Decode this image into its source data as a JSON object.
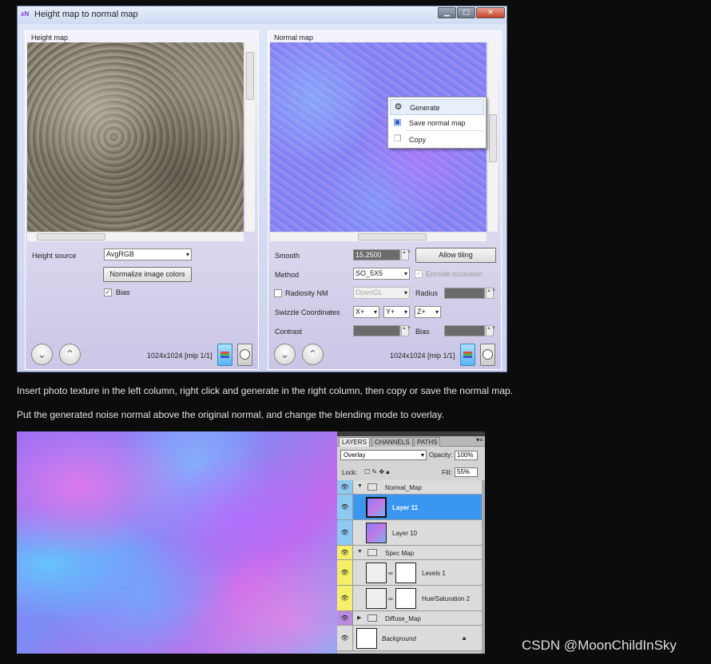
{
  "dialog": {
    "title": "Height map to normal map",
    "left": {
      "label": "Height map",
      "height_source_label": "Height source",
      "height_source_value": "AvgRGB",
      "normalize_button": "Normalize image colors",
      "bias_label": "Bias",
      "bias_checked": true,
      "resolution": "1024x1024 [mip 1/1]"
    },
    "right": {
      "label": "Normal map",
      "smooth_label": "Smooth",
      "smooth_value": "15.2500",
      "allow_tiling_button": "Allow tiling",
      "method_label": "Method",
      "method_value": "SO_5X5",
      "encode_occlusion_label": "Encode occlusion",
      "radiosity_label": "Radiosity NM",
      "radiosity_api": "OpenGL",
      "radius_label": "Radius",
      "swizzle_label": "Swizzle Coordinates",
      "swizzle_x": "X+",
      "swizzle_y": "Y+",
      "swizzle_z": "Z+",
      "contrast_label": "Contrast",
      "bias_label": "Bias",
      "resolution": "1024x1024 [mip 1/1]"
    },
    "context_menu": [
      "Generate",
      "Save normal map",
      "Copy"
    ]
  },
  "captions": [
    "Insert photo texture in the left column, right click and generate in the right column, then copy or save the normal map.",
    "Put the generated noise normal above the original normal, and change the blending mode to overlay."
  ],
  "photoshop": {
    "tabs": [
      "LAYERS",
      "CHANNELS",
      "PATHS"
    ],
    "blend_mode": "Overlay",
    "opacity_label": "Opacity:",
    "opacity_value": "100%",
    "lock_label": "Lock:",
    "fill_label": "Fill:",
    "fill_value": "55%",
    "layers": [
      {
        "name": "Normal_Map",
        "type": "group",
        "color": "#8ec9f2"
      },
      {
        "name": "Layer 11",
        "type": "layer",
        "selected": true,
        "color": "#8ec9f2"
      },
      {
        "name": "Layer 10",
        "type": "layer",
        "color": "#8ec9f2"
      },
      {
        "name": "Spec Map",
        "type": "group",
        "color": "#f4ee6a"
      },
      {
        "name": "Levels 1",
        "type": "adjustment",
        "color": "#f4ee6a"
      },
      {
        "name": "Hue/Saturation 2",
        "type": "adjustment",
        "color": "#f4ee6a"
      },
      {
        "name": "Diffuse_Map",
        "type": "group",
        "color": "#b88de0"
      },
      {
        "name": "Background",
        "type": "background"
      }
    ]
  },
  "watermark": "CSDN @MoonChildInSky"
}
